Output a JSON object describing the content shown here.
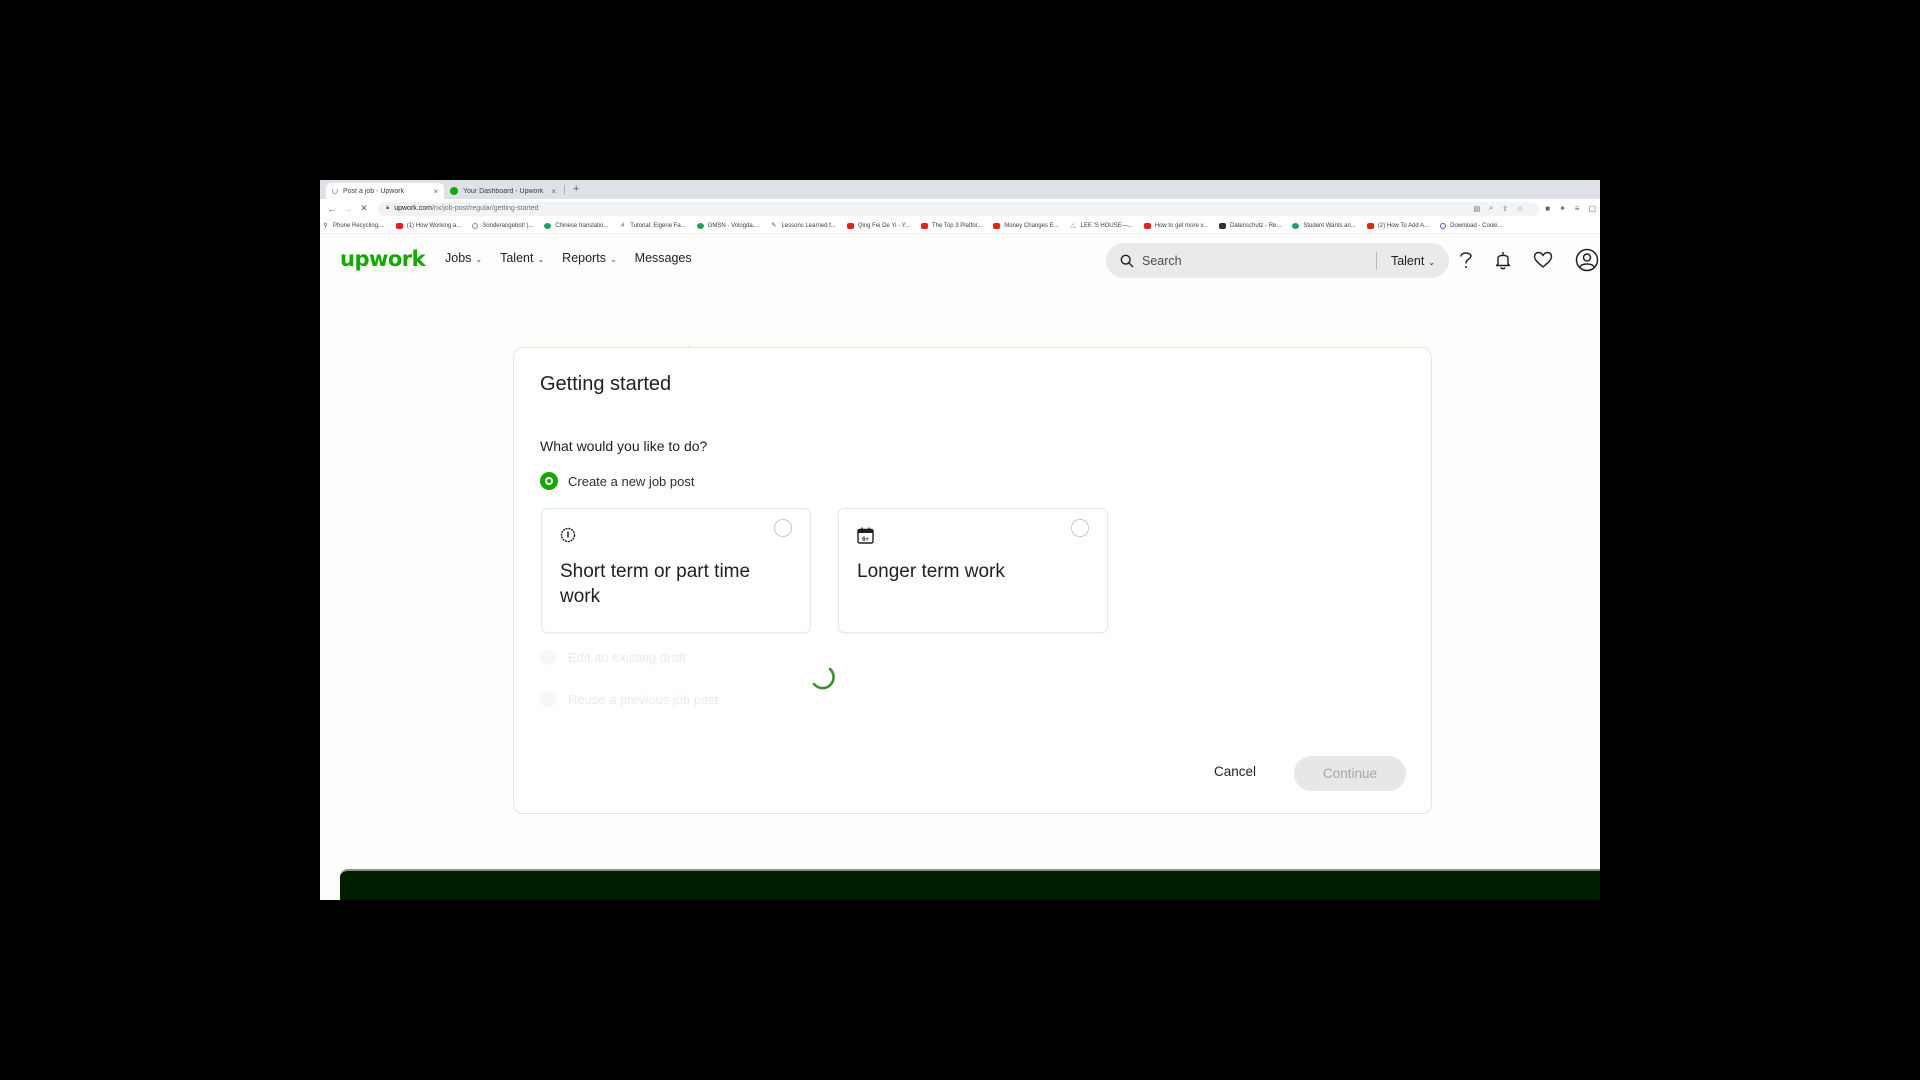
{
  "browser": {
    "tabs": [
      {
        "title": "Post a job - Upwork",
        "active": true,
        "loading": true
      },
      {
        "title": "Your Dashboard - Upwork",
        "active": false,
        "loading": false
      }
    ],
    "new_tab_label": "+",
    "close_label": "×",
    "nav": {
      "back": "←",
      "forward": "→",
      "stop": "✕"
    },
    "url": {
      "host": "upwork.com",
      "path": "/nx/job-post/regular/getting-started"
    },
    "bookmarks": [
      {
        "label": "Phone Recycling,...",
        "icon": "search-icon"
      },
      {
        "label": "(1) How Working a...",
        "icon": "youtube-icon"
      },
      {
        "label": "Sonderangebot! |...",
        "icon": "globe-icon"
      },
      {
        "label": "Chinese translatio...",
        "icon": "green-circle-icon"
      },
      {
        "label": "Tutorial: Eigene Fa...",
        "icon": "hash-icon"
      },
      {
        "label": "GMSN - Vologda,...",
        "icon": "green-circle-icon"
      },
      {
        "label": "Lessons Learned f...",
        "icon": "generic-icon"
      },
      {
        "label": "Qing Fei De Yi - Y...",
        "icon": "youtube-icon"
      },
      {
        "label": "The Top 3 Platfor...",
        "icon": "youtube-icon"
      },
      {
        "label": "Money Changes E...",
        "icon": "youtube-icon"
      },
      {
        "label": "LEE 'S HOUSE—...",
        "icon": "airbnb-icon"
      },
      {
        "label": "How to get more v...",
        "icon": "youtube-icon"
      },
      {
        "label": "Datenschutz - Re...",
        "icon": "dark-square-icon"
      },
      {
        "label": "Student Wants an...",
        "icon": "green-circle-icon"
      },
      {
        "label": "(2) How To Add A...",
        "icon": "youtube-icon"
      },
      {
        "label": "Download - Cooki...",
        "icon": "purple-ring-icon"
      }
    ]
  },
  "header": {
    "logo": "upwork",
    "nav": [
      {
        "label": "Jobs",
        "dropdown": true
      },
      {
        "label": "Talent",
        "dropdown": true
      },
      {
        "label": "Reports",
        "dropdown": true
      },
      {
        "label": "Messages",
        "dropdown": false
      }
    ],
    "search": {
      "placeholder": "Search",
      "scope": "Talent"
    },
    "icons": [
      "help-icon",
      "notifications-bell-icon",
      "favorites-heart-icon",
      "account-avatar-icon"
    ]
  },
  "main": {
    "title": "Getting started",
    "question": "What would you like to do?",
    "primary_option": {
      "label": "Create a new job post",
      "selected": true
    },
    "job_types": [
      {
        "label": "Short term or part time work",
        "icon": "clock-icon",
        "selected": false
      },
      {
        "label": "Longer term work",
        "icon": "calendar-icon",
        "icon_text": "6+",
        "selected": false
      }
    ],
    "other_options": [
      {
        "label": "Edit an existing draft",
        "disabled": true
      },
      {
        "label": "Reuse a previous job post",
        "disabled": true
      }
    ],
    "loading": true,
    "cancel_label": "Cancel",
    "continue_label": "Continue",
    "continue_disabled": true
  },
  "colors": {
    "brand_green": "#14a800",
    "footer_dark": "#001e00",
    "search_bg": "#e9ebe8",
    "disabled_button_bg": "#e6e8e5"
  }
}
